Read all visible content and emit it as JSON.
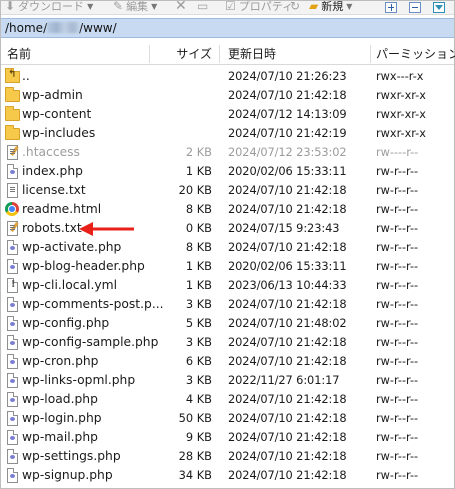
{
  "toolbar": {
    "download_label": "ダウンロード",
    "edit_label": "編集",
    "delete_glyph": "✕",
    "properties_label": "プロパティ",
    "new_label": "新規",
    "refresh_glyph": "↻"
  },
  "path": {
    "prefix": "/home/",
    "suffix": "/www/"
  },
  "columns": {
    "name": "名前",
    "size": "サイズ",
    "modified": "更新日時",
    "permissions": "パーミッション"
  },
  "files": [
    {
      "name": "..",
      "size": "",
      "date": "2024/07/10 21:26:23",
      "perm": "rwx---r-x",
      "icon": "parent-folder-icon",
      "dim": false
    },
    {
      "name": "wp-admin",
      "size": "",
      "date": "2024/07/10 21:42:18",
      "perm": "rwxr-xr-x",
      "icon": "folder-icon",
      "dim": false
    },
    {
      "name": "wp-content",
      "size": "",
      "date": "2024/07/12 14:13:09",
      "perm": "rwxr-xr-x",
      "icon": "folder-icon",
      "dim": false
    },
    {
      "name": "wp-includes",
      "size": "",
      "date": "2024/07/10 21:42:19",
      "perm": "rwxr-xr-x",
      "icon": "folder-icon",
      "dim": false
    },
    {
      "name": ".htaccess",
      "size": "2 KB",
      "date": "2024/07/12 23:53:02",
      "perm": "rw----r--",
      "icon": "text-file-icon",
      "dim": true
    },
    {
      "name": "index.php",
      "size": "1 KB",
      "date": "2020/02/06 15:33:11",
      "perm": "rw-r--r--",
      "icon": "php-file-icon",
      "dim": false
    },
    {
      "name": "license.txt",
      "size": "20 KB",
      "date": "2024/07/10 21:42:18",
      "perm": "rw-r--r--",
      "icon": "text-file-icon",
      "dim": false
    },
    {
      "name": "readme.html",
      "size": "8 KB",
      "date": "2024/07/10 21:42:18",
      "perm": "rw-r--r--",
      "icon": "chrome-icon",
      "dim": false
    },
    {
      "name": "robots.txt",
      "size": "0 KB",
      "date": "2024/07/15 9:23:43",
      "perm": "rw-r--r--",
      "icon": "text-file-icon",
      "dim": false
    },
    {
      "name": "wp-activate.php",
      "size": "8 KB",
      "date": "2024/07/10 21:42:18",
      "perm": "rw-r--r--",
      "icon": "php-file-icon",
      "dim": false
    },
    {
      "name": "wp-blog-header.php",
      "size": "1 KB",
      "date": "2020/02/06 15:33:11",
      "perm": "rw-r--r--",
      "icon": "php-file-icon",
      "dim": false
    },
    {
      "name": "wp-cli.local.yml",
      "size": "1 KB",
      "date": "2023/06/13 10:44:33",
      "perm": "rw-r--r--",
      "icon": "generic-file-icon",
      "dim": false
    },
    {
      "name": "wp-comments-post.p...",
      "size": "3 KB",
      "date": "2024/07/10 21:42:18",
      "perm": "rw-r--r--",
      "icon": "php-file-icon",
      "dim": false
    },
    {
      "name": "wp-config.php",
      "size": "5 KB",
      "date": "2024/07/10 21:48:02",
      "perm": "rw-r--r--",
      "icon": "php-file-icon",
      "dim": false
    },
    {
      "name": "wp-config-sample.php",
      "size": "3 KB",
      "date": "2024/07/10 21:42:18",
      "perm": "rw-r--r--",
      "icon": "php-file-icon",
      "dim": false
    },
    {
      "name": "wp-cron.php",
      "size": "6 KB",
      "date": "2024/07/10 21:42:18",
      "perm": "rw-r--r--",
      "icon": "php-file-icon",
      "dim": false
    },
    {
      "name": "wp-links-opml.php",
      "size": "3 KB",
      "date": "2022/11/27 6:01:17",
      "perm": "rw-r--r--",
      "icon": "php-file-icon",
      "dim": false
    },
    {
      "name": "wp-load.php",
      "size": "4 KB",
      "date": "2024/07/10 21:42:18",
      "perm": "rw-r--r--",
      "icon": "php-file-icon",
      "dim": false
    },
    {
      "name": "wp-login.php",
      "size": "50 KB",
      "date": "2024/07/10 21:42:18",
      "perm": "rw-r--r--",
      "icon": "php-file-icon",
      "dim": false
    },
    {
      "name": "wp-mail.php",
      "size": "9 KB",
      "date": "2024/07/10 21:42:18",
      "perm": "rw-r--r--",
      "icon": "php-file-icon",
      "dim": false
    },
    {
      "name": "wp-settings.php",
      "size": "28 KB",
      "date": "2024/07/10 21:42:18",
      "perm": "rw-r--r--",
      "icon": "php-file-icon",
      "dim": false
    },
    {
      "name": "wp-signup.php",
      "size": "34 KB",
      "date": "2024/07/10 21:42:18",
      "perm": "rw-r--r--",
      "icon": "php-file-icon",
      "dim": false
    }
  ],
  "annotation": {
    "arrow_color": "#e8201a",
    "points_to": "robots.txt"
  },
  "colors": {
    "pathbar_bg": "#c7daf1",
    "folder": "#f6c94b",
    "dim_text": "#9c9c9c"
  }
}
